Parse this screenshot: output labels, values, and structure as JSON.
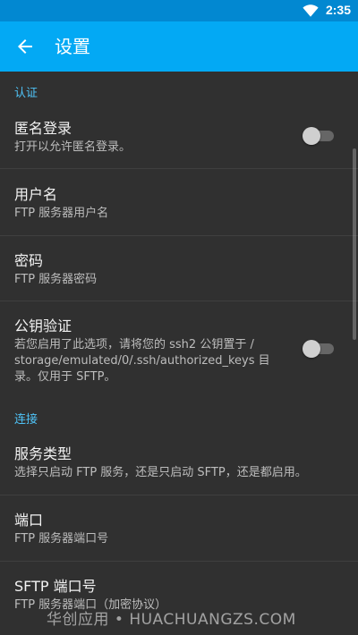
{
  "status_bar": {
    "time": "2:35",
    "wifi_icon": "wifi-icon"
  },
  "app_bar": {
    "title": "设置",
    "back_icon": "arrow-back-icon"
  },
  "sections": {
    "auth": {
      "header": "认证"
    },
    "connection": {
      "header": "连接"
    }
  },
  "prefs": {
    "anonymous": {
      "title": "匿名登录",
      "summary": "打开以允许匿名登录。",
      "enabled": false
    },
    "username": {
      "title": "用户名",
      "summary": "FTP 服务器用户名"
    },
    "password": {
      "title": "密码",
      "summary": "FTP 服务器密码"
    },
    "pubkey": {
      "title": "公钥验证",
      "summary_line1": "若您启用了此选项，请将您的 ssh2 公钥置于 /",
      "summary_line2": "storage/emulated/0/.ssh/authorized_keys 目",
      "summary_line3": "录。仅用于 SFTP。",
      "enabled": false
    },
    "service_type": {
      "title": "服务类型",
      "summary": "选择只启动 FTP 服务，还是只启动 SFTP，还是都启用。"
    },
    "port": {
      "title": "端口",
      "summary": "FTP 服务器端口号"
    },
    "sftp_port": {
      "title": "SFTP 端口号",
      "summary": "FTP 服务器端口（加密协议）"
    }
  },
  "watermark": "华创应用 • HUACHUANGZS.COM",
  "colors": {
    "accent": "#03A9F4",
    "status_bar": "#0288D1",
    "background": "#303030",
    "section_header": "#4FC3F7"
  }
}
